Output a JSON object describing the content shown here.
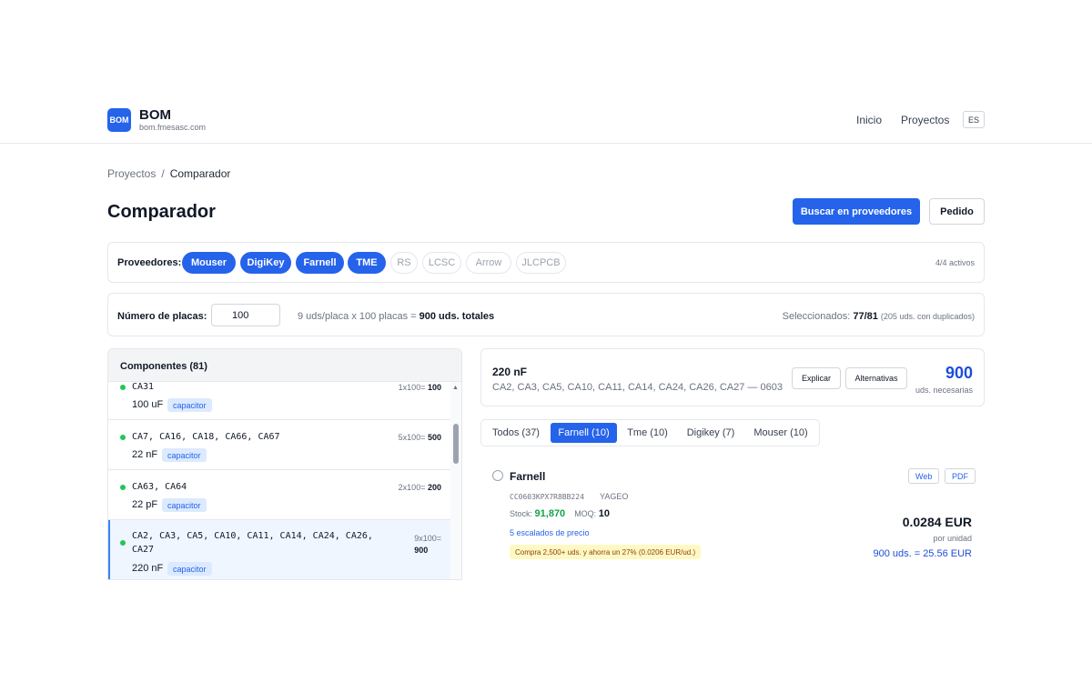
{
  "header": {
    "logo_text": "BOM",
    "brand_name": "BOM",
    "brand_url": "bom.fmesasc.com",
    "nav": [
      "Inicio",
      "Proyectos"
    ],
    "lang": "ES"
  },
  "breadcrumb": {
    "parent": "Proyectos",
    "separator": "/",
    "current": "Comparador"
  },
  "page": {
    "title": "Comparador",
    "search_button": "Buscar en proveedores",
    "order_button": "Pedido"
  },
  "providers": {
    "label": "Proveedores:",
    "chips": [
      {
        "label": "Mouser",
        "active": true
      },
      {
        "label": "DigiKey",
        "active": true
      },
      {
        "label": "Farnell",
        "active": true
      },
      {
        "label": "TME",
        "active": true
      },
      {
        "label": "RS",
        "active": false
      },
      {
        "label": "LCSC",
        "active": false
      },
      {
        "label": "Arrow",
        "active": false
      },
      {
        "label": "JLCPCB",
        "active": false
      }
    ],
    "count": "4/4 activos"
  },
  "plates": {
    "label": "Número de placas:",
    "value": "100",
    "formula_prefix": "9 uds/placa x 100 placas =",
    "formula_total": "900 uds. totales",
    "selected_label": "Seleccionados:",
    "selected_value": "77/81",
    "selected_note": "(205 uds. con duplicados)"
  },
  "components": {
    "title": "Componentes (81)",
    "rows": [
      {
        "refs": "CA31",
        "value": "100 uF",
        "tag": "capacitor",
        "qty_formula": "1x100=",
        "qty_total": "100"
      },
      {
        "refs": "CA7, CA16, CA18, CA66, CA67",
        "value": "22 nF",
        "tag": "capacitor",
        "qty_formula": "5x100=",
        "qty_total": "500"
      },
      {
        "refs": "CA63, CA64",
        "value": "22 pF",
        "tag": "capacitor",
        "qty_formula": "2x100=",
        "qty_total": "200"
      },
      {
        "refs_line1": "CA2, CA3, CA5, CA10, CA11, CA14, CA24, CA26,",
        "refs_line2": "CA27",
        "value": "220 nF",
        "tag": "capacitor",
        "qty_formula": "9x100=",
        "qty_total": "900"
      }
    ]
  },
  "detail": {
    "value": "220 nF",
    "refs": "CA2, CA3, CA5, CA10, CA11, CA14, CA24, CA26, CA27 — 0603",
    "explain_button": "Explicar",
    "alternatives_button": "Alternativas",
    "needed_number": "900",
    "needed_label": "uds. necesarias"
  },
  "tabs": [
    "Todos (37)",
    "Farnell (10)",
    "Tme (10)",
    "Digikey (7)",
    "Mouser (10)"
  ],
  "offer": {
    "supplier": "Farnell",
    "web_link": "Web",
    "pdf_link": "PDF",
    "sku": "CC0603KPX7R8BB224",
    "brand": "YAGEO",
    "stock_label": "Stock:",
    "stock_value": "91,870",
    "moq_label": "MOQ:",
    "moq_value": "10",
    "tiers_link": "5 escalados de precio",
    "promo": "Compra 2,500+ uds. y ahorra un 27% (0.0206 EUR/ud.)",
    "price": "0.0284 EUR",
    "price_unit": "por unidad",
    "price_total": "900 uds. = 25.56 EUR"
  },
  "colors": {
    "accent": "#2563eb",
    "stock": "#16a34a",
    "promo_bg": "#fef9c3"
  },
  "icons": {
    "status_dot": "status-dot-icon",
    "scroll_up": "chevron-up-icon",
    "radio": "radio-icon"
  }
}
